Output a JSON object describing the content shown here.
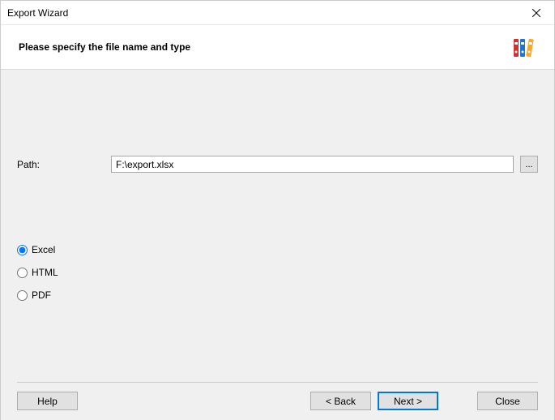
{
  "window": {
    "title": "Export Wizard"
  },
  "header": {
    "subtitle": "Please specify the file name and type"
  },
  "form": {
    "path_label": "Path:",
    "path_value": "F:\\export.xlsx",
    "browse_label": "...",
    "formats": [
      {
        "label": "Excel",
        "checked": true
      },
      {
        "label": "HTML",
        "checked": false
      },
      {
        "label": "PDF",
        "checked": false
      }
    ]
  },
  "buttons": {
    "help": "Help",
    "back": "< Back",
    "next": "Next >",
    "close": "Close"
  }
}
